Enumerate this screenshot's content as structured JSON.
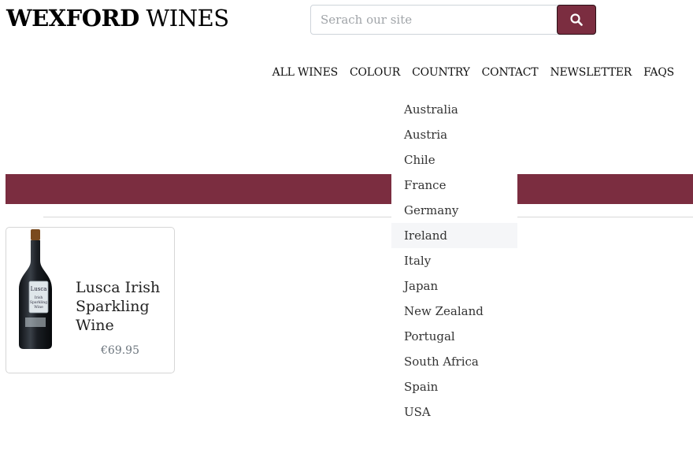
{
  "brand": {
    "bold": "WEXFORD",
    "light": " WINES"
  },
  "search": {
    "placeholder": "Serach our site",
    "value": ""
  },
  "nav": {
    "items": [
      {
        "label": "ALL WINES"
      },
      {
        "label": "COLOUR"
      },
      {
        "label": "COUNTRY"
      },
      {
        "label": "CONTACT"
      },
      {
        "label": "NEWSLETTER"
      },
      {
        "label": "FAQS"
      }
    ]
  },
  "country_dropdown": {
    "items": [
      {
        "label": "Australia"
      },
      {
        "label": "Austria"
      },
      {
        "label": "Chile"
      },
      {
        "label": "France"
      },
      {
        "label": "Germany"
      },
      {
        "label": "Ireland"
      },
      {
        "label": "Italy"
      },
      {
        "label": "Japan"
      },
      {
        "label": "New Zealand"
      },
      {
        "label": "Portugal"
      },
      {
        "label": "South Africa"
      },
      {
        "label": "Spain"
      },
      {
        "label": "USA"
      }
    ],
    "highlighted": "Ireland"
  },
  "product": {
    "name": "Lusca Irish Sparkling Wine",
    "price": "€69.95",
    "bottle_label": {
      "brand": "Lusca",
      "line1": "Irish",
      "line2": "Sparkling",
      "line3": "Wine"
    }
  },
  "colors": {
    "accent": "#7b2d40",
    "text": "#212529",
    "muted": "#6c757d",
    "highlight": "#f5f6f8"
  },
  "icons": {
    "search": "search-icon"
  }
}
